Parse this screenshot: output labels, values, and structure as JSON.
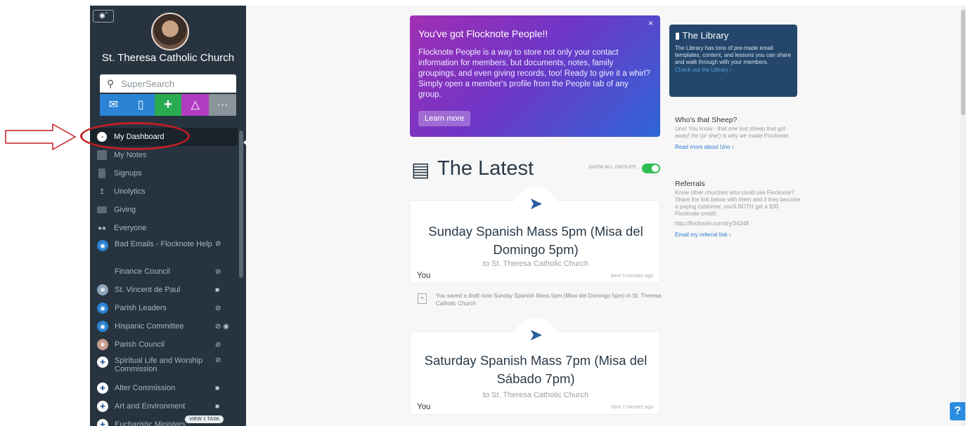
{
  "sidebar": {
    "account_icon": "user-circle-icon",
    "church_name": "St. Theresa Catholic Church",
    "search_placeholder": "SuperSearch",
    "actions": [
      {
        "icon": "envelope-icon",
        "color": "#2a83d4"
      },
      {
        "icon": "phone-icon",
        "color": "#2a83d4"
      },
      {
        "icon": "plus-icon",
        "color": "#2aab4f"
      },
      {
        "icon": "bell-icon",
        "color": "#b23cc0"
      },
      {
        "icon": "more-icon",
        "color": "#8a949b"
      }
    ],
    "nav": [
      {
        "label": "My Dashboard",
        "icon": "dashboard-icon"
      },
      {
        "label": "My Notes",
        "icon": "notes-icon"
      },
      {
        "label": "Signups",
        "icon": "signups-icon"
      },
      {
        "label": "Unolytics",
        "icon": "chart-icon"
      },
      {
        "label": "Giving",
        "icon": "money-icon"
      },
      {
        "label": "Everyone",
        "icon": "people-icon"
      }
    ],
    "groups": [
      {
        "label": "Bad Emails - Flocknote Help",
        "status": "hidden-icon"
      },
      {
        "label": "Finance Council",
        "status": "hidden-icon"
      },
      {
        "label": "St. Vincent de Paul",
        "status": "lock-icon"
      },
      {
        "label": "Parish Leaders",
        "status": "hidden-icon"
      },
      {
        "label": "Hispanic Committee",
        "status": "hidden-icon"
      },
      {
        "label": "Parish Council",
        "status": "hidden-icon"
      },
      {
        "label": "Spiritual Life and Worship Commission",
        "status": "hidden-icon"
      },
      {
        "label": "Alter Commission",
        "status": "lock-icon"
      },
      {
        "label": "Art and Environment",
        "status": "lock-icon"
      },
      {
        "label": "Eucharistic Ministers",
        "task": "VIEW 1 TASK"
      }
    ]
  },
  "promo": {
    "title": "You've got Flocknote People!!",
    "body": "Flocknote People is a way to store not only your contact information for members, but documents, notes, family groupings, and even giving records, too! Ready to give it a whirl? Simply open a member's profile from the People tab of any group.",
    "button": "Learn more",
    "close": "×"
  },
  "latest": {
    "title": "The Latest",
    "toggle_label": "SHOW ALL GROUPS",
    "notes": [
      {
        "title": "Sunday Spanish Mass 5pm (Misa del Domingo 5pm)",
        "to": "to St. Theresa Catholic Church",
        "author": "You",
        "sent": "Sent 5 minutes ago"
      },
      {
        "title": "Saturday Spanish Mass 7pm (Misa del Sábado 7pm)",
        "to": "to St. Theresa Catholic Church",
        "author": "You",
        "sent": "Sent 7 minutes ago"
      }
    ],
    "activity": "You saved a draft note Sunday Spanish Mass 5pm (Misa del Domingo 5pm) in St. Theresa Catholic Church"
  },
  "library": {
    "title": "The Library",
    "body": "The Library has tons of pre-made email templates, content, and lessons you can share and walk through with your members.",
    "link": "Check out the Library ›"
  },
  "sheep": {
    "title": "Who's that Sheep?",
    "body": "Uno! You know - that one lost sheep that got away! He (or she!) is why we made Flocknote.",
    "link": "Read more about Uno ›"
  },
  "referrals": {
    "title": "Referrals",
    "body": "Know other churches who could use Flocknote? Share the link below with them and if they become a paying customer, you'll BOTH get a $30 Flocknote credit!",
    "url": "http://flocknote.com/try/34248",
    "link": "Email my referral link ›"
  },
  "help_label": "?"
}
